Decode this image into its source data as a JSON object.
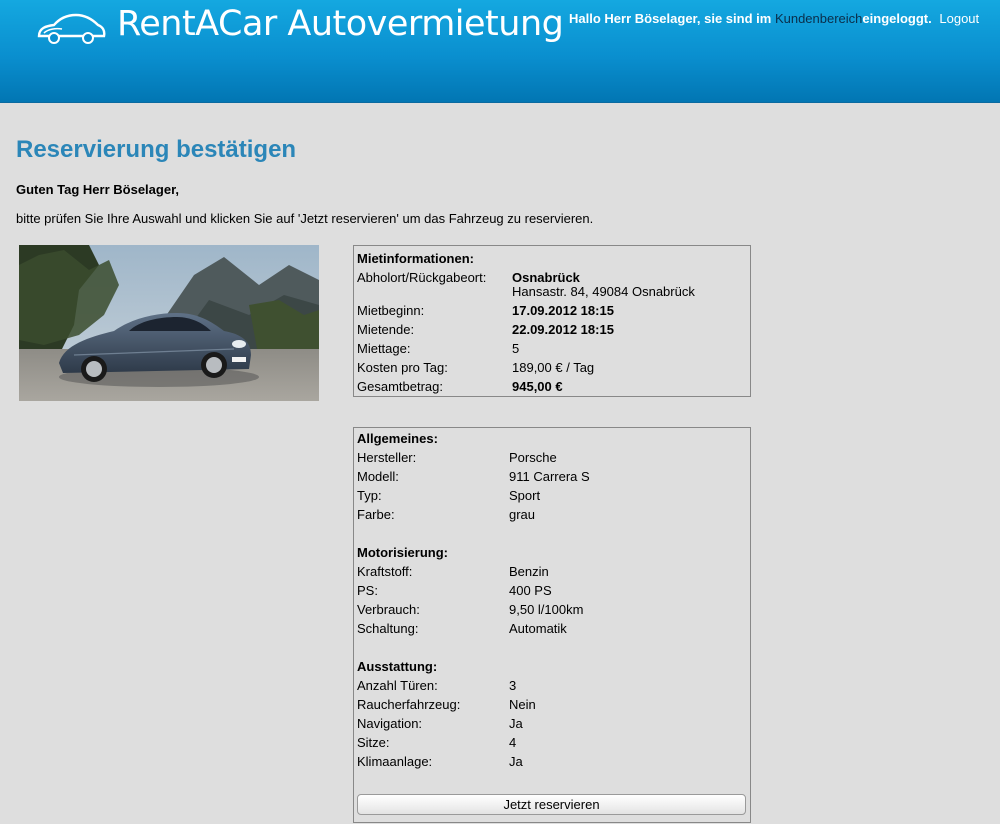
{
  "header": {
    "brand": "RentACar Autovermietung",
    "greeting_prefix": "Hallo Herr Böselager, sie sind im",
    "customer_area_link": "Kundenbereich",
    "greeting_suffix": "eingeloggt.",
    "logout_link": "Logout",
    "logo_icon": "car-icon"
  },
  "page": {
    "title": "Reservierung bestätigen",
    "greeting": "Guten Tag Herr Böselager,",
    "intro": "bitte prüfen Sie Ihre Auswahl und klicken Sie auf 'Jetzt reservieren' um das Fahrzeug zu reservieren."
  },
  "rental": {
    "heading": "Mietinformationen:",
    "location_label": "Abholort/Rückgabeort:",
    "location_city": "Osnabrück",
    "location_address": "Hansastr. 84, 49084 Osnabrück",
    "start_label": "Mietbeginn:",
    "start_value": "17.09.2012 18:15",
    "end_label": "Mietende:",
    "end_value": "22.09.2012 18:15",
    "days_label": "Miettage:",
    "days_value": "5",
    "cost_label": "Kosten pro Tag:",
    "cost_value": "189,00 € / Tag",
    "total_label": "Gesamtbetrag:",
    "total_value": "945,00 €"
  },
  "vehicle": {
    "general_heading": "Allgemeines:",
    "general": [
      {
        "label": "Hersteller:",
        "value": "Porsche"
      },
      {
        "label": "Modell:",
        "value": "911 Carrera S"
      },
      {
        "label": "Typ:",
        "value": "Sport"
      },
      {
        "label": "Farbe:",
        "value": "grau"
      }
    ],
    "engine_heading": "Motorisierung:",
    "engine": [
      {
        "label": "Kraftstoff:",
        "value": "Benzin"
      },
      {
        "label": "PS:",
        "value": "400 PS"
      },
      {
        "label": "Verbrauch:",
        "value": "9,50 l/100km"
      },
      {
        "label": "Schaltung:",
        "value": "Automatik"
      }
    ],
    "equipment_heading": "Ausstattung:",
    "equipment": [
      {
        "label": "Anzahl Türen:",
        "value": "3"
      },
      {
        "label": "Raucherfahrzeug:",
        "value": "Nein"
      },
      {
        "label": "Navigation:",
        "value": "Ja"
      },
      {
        "label": "Sitze:",
        "value": "4"
      },
      {
        "label": "Klimaanlage:",
        "value": "Ja"
      }
    ]
  },
  "actions": {
    "reserve_label": "Jetzt reservieren"
  },
  "colors": {
    "header_blue": "#0a8fcf",
    "title_blue": "#2b86b8",
    "background": "#dedede"
  }
}
